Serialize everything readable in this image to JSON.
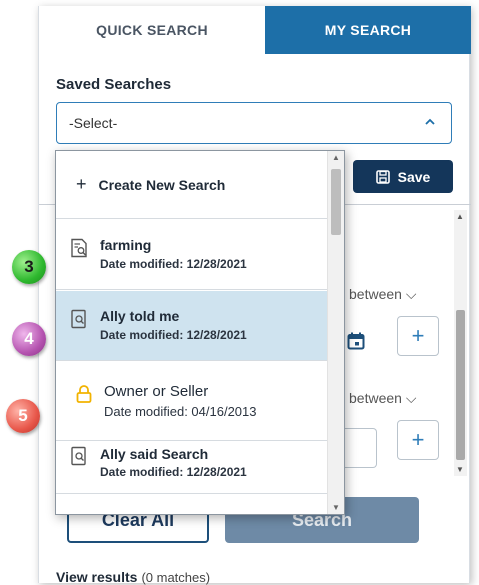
{
  "tabs": {
    "quick": "QUICK SEARCH",
    "my": "MY SEARCH"
  },
  "saved_searches": {
    "label": "Saved Searches",
    "select_value": "-Select-",
    "save_label": "Save"
  },
  "dropdown": {
    "create_label": "Create New Search",
    "items": [
      {
        "name": "farming",
        "date": "Date modified: 12/28/2021",
        "icon": "saved-search-list-icon"
      },
      {
        "name": "Ally told me",
        "date": "Date modified: 12/28/2021",
        "icon": "saved-search-icon"
      },
      {
        "name": "Owner or Seller",
        "date": "Date modified: 04/16/2013",
        "icon": "lock-icon"
      },
      {
        "name": "Ally said Search",
        "date": "Date modified: 12/28/2021",
        "icon": "saved-search-icon"
      }
    ]
  },
  "filters": {
    "between1": "between",
    "between2": "between"
  },
  "actions": {
    "clear": "Clear All",
    "search": "Search"
  },
  "results": {
    "label": "View results",
    "count": "(0 matches)"
  },
  "badges": {
    "b3": "3",
    "b4": "4",
    "b5": "5"
  },
  "colors": {
    "accent": "#1d6fa8",
    "save_bg": "#14365a",
    "selected": "#cfe3ef",
    "lock": "#f2b300"
  }
}
